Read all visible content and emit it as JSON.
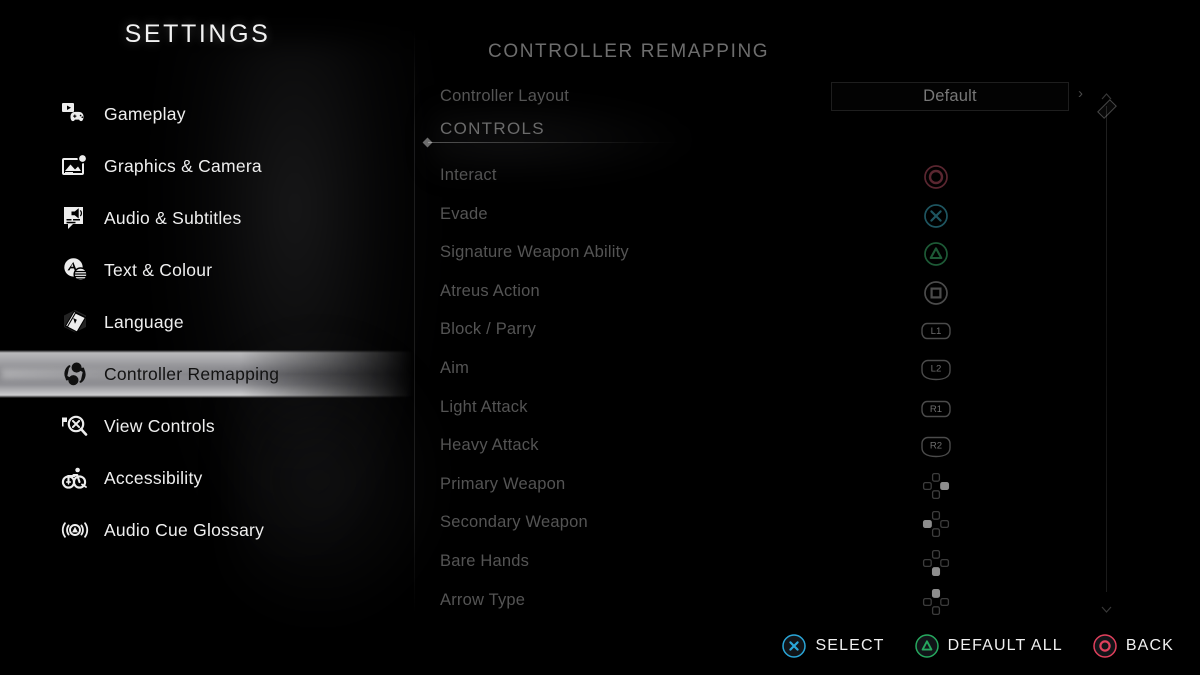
{
  "window": {
    "title": "SETTINGS"
  },
  "sidebar": {
    "title": "SETTINGS",
    "items": [
      {
        "label": "Gameplay",
        "icon": "gameplay-controller-icon",
        "selected": false
      },
      {
        "label": "Graphics & Camera",
        "icon": "graphics-camera-icon",
        "selected": false
      },
      {
        "label": "Audio & Subtitles",
        "icon": "audio-subtitles-icon",
        "selected": false
      },
      {
        "label": "Text & Colour",
        "icon": "text-colour-icon",
        "selected": false
      },
      {
        "label": "Language",
        "icon": "language-book-icon",
        "selected": false
      },
      {
        "label": "Controller Remapping",
        "icon": "controller-remap-icon",
        "selected": true
      },
      {
        "label": "View Controls",
        "icon": "view-controls-icon",
        "selected": false
      },
      {
        "label": "Accessibility",
        "icon": "accessibility-icon",
        "selected": false
      },
      {
        "label": "Audio Cue Glossary",
        "icon": "audio-cue-glossary-icon",
        "selected": false
      }
    ]
  },
  "panel": {
    "title": "CONTROLLER REMAPPING",
    "layout_row": {
      "label": "Controller Layout",
      "value": "Default",
      "chevron": "›"
    },
    "section": {
      "heading": "CONTROLS"
    },
    "rows": [
      {
        "name": "Interact",
        "binding": "circle",
        "binding_label": ""
      },
      {
        "name": "Evade",
        "binding": "cross",
        "binding_label": ""
      },
      {
        "name": "Signature Weapon Ability",
        "binding": "triangle",
        "binding_label": ""
      },
      {
        "name": "Atreus Action",
        "binding": "square",
        "binding_label": ""
      },
      {
        "name": "Block / Parry",
        "binding": "bumper",
        "binding_label": "L1"
      },
      {
        "name": "Aim",
        "binding": "trigger",
        "binding_label": "L2"
      },
      {
        "name": "Light Attack",
        "binding": "bumper",
        "binding_label": "R1"
      },
      {
        "name": "Heavy Attack",
        "binding": "trigger",
        "binding_label": "R2"
      },
      {
        "name": "Primary Weapon",
        "binding": "dpad-right",
        "binding_label": ""
      },
      {
        "name": "Secondary Weapon",
        "binding": "dpad-left",
        "binding_label": ""
      },
      {
        "name": "Bare Hands",
        "binding": "dpad-down",
        "binding_label": ""
      },
      {
        "name": "Arrow Type",
        "binding": "dpad-up",
        "binding_label": ""
      }
    ]
  },
  "scrollbar": {
    "up_arrow": "⌃",
    "down_arrow": "⌄",
    "position": "top"
  },
  "footer": {
    "buttons": [
      {
        "label": "SELECT",
        "icon": "cross-button-icon",
        "color": "#2aa6d8"
      },
      {
        "label": "DEFAULT ALL",
        "icon": "triangle-button-icon",
        "color": "#26a85e"
      },
      {
        "label": "BACK",
        "icon": "circle-button-icon",
        "color": "#e0405c"
      }
    ]
  },
  "colors": {
    "background": "#000000",
    "text_primary": "#efefef",
    "text_dim": "#545454",
    "highlight_metal": "#b0b0b4",
    "ps_circle": "#5a2630",
    "ps_cross": "#1e5560",
    "ps_triangle": "#1d5a36",
    "ps_square": "#4b4b4b"
  }
}
